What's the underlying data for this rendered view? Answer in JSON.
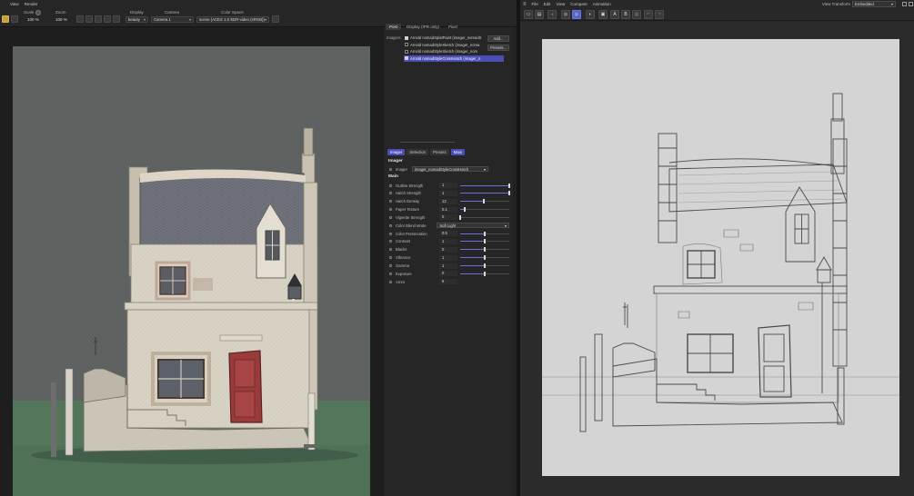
{
  "left_window": {
    "menu": [
      "View",
      "Render"
    ],
    "toolbar": {
      "scale_label": "Scale",
      "scale_value": "100 %",
      "zoom_label": "Zoom",
      "zoom_value": "100 %",
      "display_label": "Display",
      "display_value": "beauty",
      "camera_label": "Camera",
      "camera_value": "Camera.1",
      "color_space_label": "Color Space",
      "color_space_value": "scene (ACES 1.0 SDR-video (sRGB))"
    }
  },
  "settings_panel": {
    "tabs": [
      "Post",
      "Display (IPR only)",
      "Pixel"
    ],
    "active_tab": "Post",
    "imagers_label": "Imagers",
    "imagers": [
      {
        "label": "Arnold nomadSplatPaint (imager_nomadS",
        "checked": true,
        "selected": false
      },
      {
        "label": "Arnold nomadStyleSketch (imager_noma",
        "checked": false,
        "selected": false
      },
      {
        "label": "Arnold nomadStyleSketch (imager_nom",
        "checked": false,
        "selected": false
      },
      {
        "label": "Arnold nomadStyleCrossHatch (imager_n",
        "checked": true,
        "selected": true
      }
    ],
    "add_button": "Add...",
    "presets_button": "Presets...",
    "sub_tabs": [
      "Imager",
      "Selection",
      "Presets",
      "Main"
    ],
    "imager_section_title": "Imager",
    "imager_field_label": "Imager",
    "imager_field_value": "imager_nomadStyleCrossHatch",
    "main_section_title": "Main",
    "params": [
      {
        "name": "Outline Strength",
        "value": "1",
        "fraction": 1.0,
        "type": "slider"
      },
      {
        "name": "Hatch Strength",
        "value": "1",
        "fraction": 1.0,
        "type": "slider"
      },
      {
        "name": "Hatch Density",
        "value": "12",
        "fraction": 0.48,
        "type": "slider"
      },
      {
        "name": "Paper Texture",
        "value": "0.1",
        "fraction": 0.1,
        "type": "slider"
      },
      {
        "name": "Vignette Strength",
        "value": "0",
        "fraction": 0.0,
        "type": "slider"
      },
      {
        "name": "Color Blend Mode",
        "value": "Soft Light",
        "type": "select"
      },
      {
        "name": "Color Preservation",
        "value": "0.5",
        "fraction": 0.5,
        "type": "slider"
      },
      {
        "name": "Contrast",
        "value": "1",
        "fraction": 0.5,
        "type": "slider"
      },
      {
        "name": "Blacks",
        "value": "0",
        "fraction": 0.5,
        "type": "slider"
      },
      {
        "name": "Vibrance",
        "value": "1",
        "fraction": 0.5,
        "type": "slider"
      },
      {
        "name": "Gamma",
        "value": "1",
        "fraction": 0.5,
        "type": "slider"
      },
      {
        "name": "Exposure",
        "value": "0",
        "fraction": 0.5,
        "type": "slider"
      },
      {
        "name": "Arnm",
        "value": "6",
        "type": "text"
      }
    ]
  },
  "right_window": {
    "menu": [
      "File",
      "Edit",
      "View",
      "Compare",
      "Animation"
    ],
    "toolbar_icons": [
      "open-folder-icon",
      "save-icon",
      "back-icon",
      "target-icon",
      "target-active-icon",
      "contrast-icon",
      "snapshot-icon",
      "compare-a-icon",
      "compare-b-icon",
      "wipe-icon",
      "undo-icon",
      "redo-icon"
    ],
    "toolbar_letters": {
      "a": "A",
      "b": "B"
    },
    "view_transform_label": "View Transform",
    "view_transform_value": "Embedded"
  },
  "colors": {
    "accent": "#4a4eb5",
    "active_tool": "#c9a13a",
    "background": "#1d1d1d"
  }
}
